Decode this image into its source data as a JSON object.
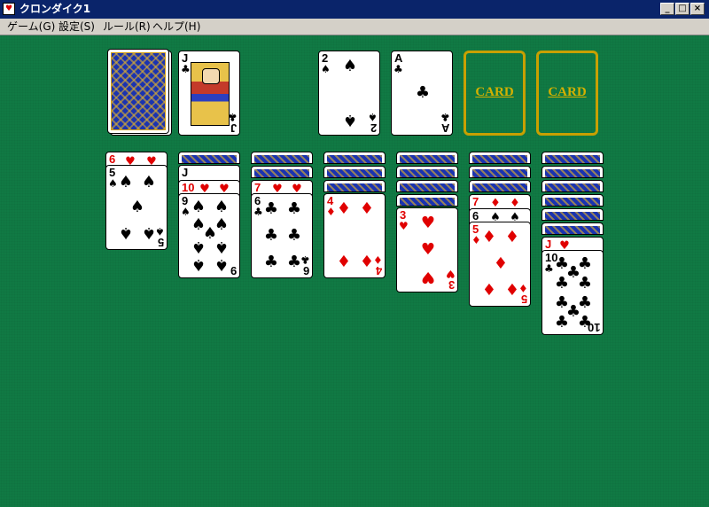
{
  "window": {
    "title": "クロンダイク1",
    "buttons": [
      "_",
      "□",
      "×"
    ]
  },
  "menu": {
    "items": [
      "ゲーム(G)",
      "設定(S)",
      "ルール(R)",
      "ヘルプ(H)"
    ]
  },
  "foundation_slots": {
    "label": "CARD"
  },
  "cards": {
    "waste_top": {
      "rank": "J",
      "suit": "♣"
    },
    "foundation_1": {
      "rank": "2",
      "suit": "♠"
    },
    "foundation_2": {
      "rank": "A",
      "suit": "♣"
    },
    "t1_under": {
      "rank": "6",
      "suit": "♥"
    },
    "t1_top": {
      "rank": "5",
      "suit": "♠"
    },
    "t2_under": {
      "rank": "J"
    },
    "t2_mid": {
      "rank": "10",
      "suit": "♥"
    },
    "t2_top": {
      "rank": "9",
      "suit": "♠"
    },
    "t3_under": {
      "rank": "7",
      "suit": "♥"
    },
    "t3_top": {
      "rank": "6",
      "suit": "♣"
    },
    "t4_top": {
      "rank": "4",
      "suit": "♦"
    },
    "t5_top": {
      "rank": "3",
      "suit": "♥"
    },
    "t6_under1": {
      "rank": "7",
      "suit": "♦"
    },
    "t6_under2": {
      "rank": "6",
      "suit": "♠"
    },
    "t6_top": {
      "rank": "5",
      "suit": "♦"
    },
    "t7_under": {
      "rank": "J",
      "suit": "♥"
    },
    "t7_top": {
      "rank": "10",
      "suit": "♣"
    }
  }
}
